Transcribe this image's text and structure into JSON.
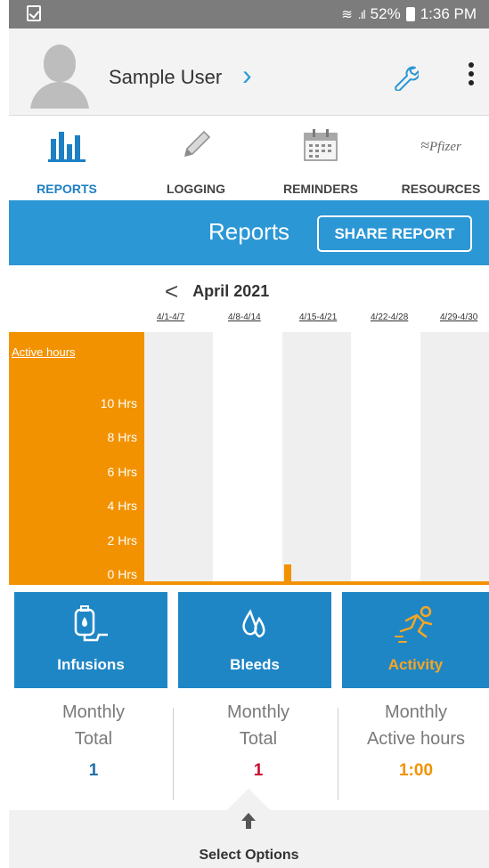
{
  "status_bar": {
    "battery": "52%",
    "time": "1:36 PM"
  },
  "header": {
    "username": "Sample User"
  },
  "tabs": [
    {
      "label": "REPORTS",
      "icon": "bar-chart-icon",
      "active": true
    },
    {
      "label": "LOGGING",
      "icon": "pencil-icon",
      "active": false
    },
    {
      "label": "REMINDERS",
      "icon": "calendar-icon",
      "active": false
    },
    {
      "label": "RESOURCES",
      "icon": "pfizer-logo",
      "active": false,
      "logo_text": "Pfizer"
    }
  ],
  "reports_bar": {
    "title": "Reports",
    "share_label": "SHARE REPORT"
  },
  "month_nav": {
    "prev_symbol": "<",
    "month": "April 2021"
  },
  "weeks": [
    "4/1-4/7",
    "4/8-4/14",
    "4/15-4/21",
    "4/22-4/28",
    "4/29-4/30"
  ],
  "chart_data": {
    "type": "bar",
    "title": "",
    "ylabel": "Active hours",
    "categories": [
      "4/1-4/7",
      "4/8-4/14",
      "4/15-4/21",
      "4/22-4/28",
      "4/29-4/30"
    ],
    "yticks": [
      "10 Hrs",
      "8 Hrs",
      "6 Hrs",
      "4 Hrs",
      "2 Hrs",
      "0 Hrs"
    ],
    "ylim": [
      0,
      11
    ],
    "points": [
      {
        "week": "4/15-4/21",
        "hours": 1
      }
    ],
    "colors": {
      "bar": "#f39200",
      "column_shade": "#efefef"
    }
  },
  "categories": [
    {
      "label": "Infusions",
      "icon": "infusion-bag-icon",
      "active": false
    },
    {
      "label": "Bleeds",
      "icon": "blood-drops-icon",
      "active": false
    },
    {
      "label": "Activity",
      "icon": "running-person-icon",
      "active": true
    }
  ],
  "totals": [
    {
      "line1": "Monthly",
      "line2": "Total",
      "value": "1",
      "color": "#1f6fa8"
    },
    {
      "line1": "Monthly",
      "line2": "Total",
      "value": "1",
      "color": "#c8102e"
    },
    {
      "line1": "Monthly",
      "line2": "Active hours",
      "value": "1:00",
      "color": "#f39200"
    }
  ],
  "options": {
    "label": "Select Options"
  },
  "colors": {
    "accent_blue": "#2b97d5",
    "accent_orange": "#f39200"
  }
}
